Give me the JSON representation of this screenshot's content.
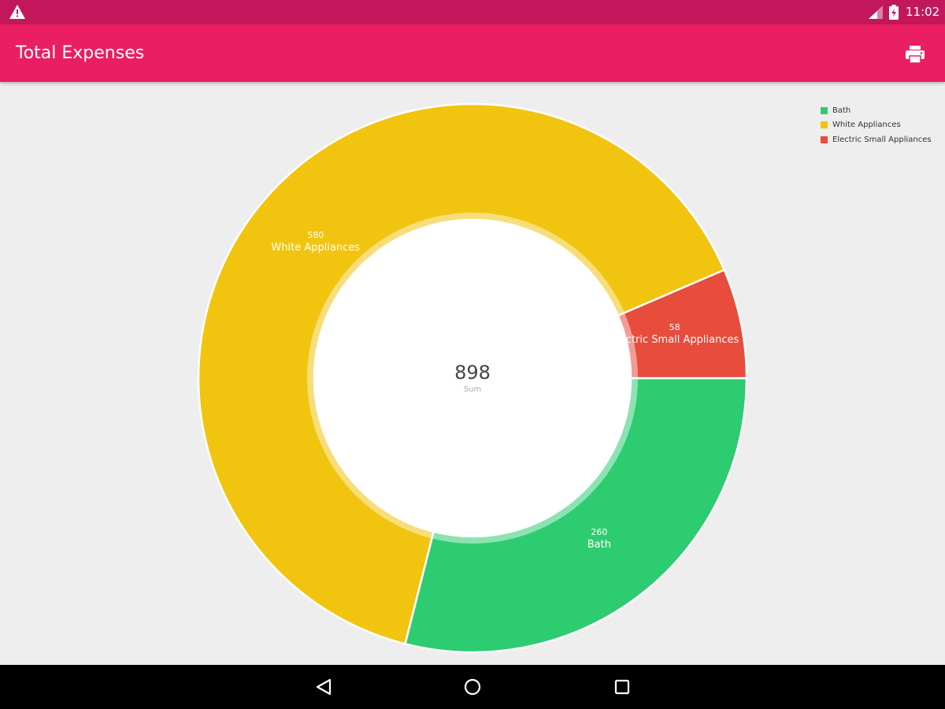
{
  "status_bar": {
    "time": "11:02",
    "icons": [
      "warning-icon",
      "signal-icon",
      "battery-icon"
    ]
  },
  "app_bar": {
    "title": "Total Expenses",
    "color": "#e91e63",
    "actions": [
      "print-icon"
    ]
  },
  "summary": {
    "center_value": "898",
    "center_label": "Sum"
  },
  "legend": [
    {
      "label": "Bath",
      "color": "#2ecc71"
    },
    {
      "label": "White Appliances",
      "color": "#f1c40f"
    },
    {
      "label": "Electric Small Appliances",
      "color": "#e74c3c"
    }
  ],
  "chart_data": {
    "type": "pie",
    "style": "donut",
    "categories": [
      "Bath",
      "White Appliances",
      "Electric Small Appliances"
    ],
    "values": [
      260,
      580,
      58
    ],
    "value_labels": [
      "260",
      "580",
      "58"
    ],
    "colors": [
      "#2ecc71",
      "#f1c40f",
      "#e74c3c"
    ],
    "total": 898,
    "legend_position": "top-right"
  },
  "nav_bar": {
    "buttons": [
      "back-icon",
      "home-icon",
      "recents-icon"
    ]
  }
}
